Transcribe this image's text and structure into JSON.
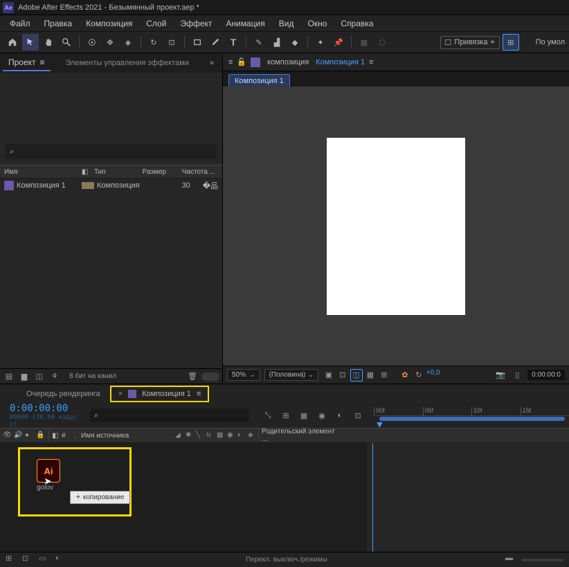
{
  "title": "Adobe After Effects 2021 - Безымянный проект.aep *",
  "logo": "Ae",
  "menu": [
    "Файл",
    "Правка",
    "Композиция",
    "Слой",
    "Эффект",
    "Анимация",
    "Вид",
    "Окно",
    "Справка"
  ],
  "toolbar": {
    "snap_label": "Привязка",
    "workspace_label": "По умол"
  },
  "project": {
    "tab": "Проект",
    "effect_controls": "Элементы управления эффектами",
    "headers": {
      "name": "Имя",
      "type": "Тип",
      "size": "Размер",
      "rate": "Частота ..."
    },
    "row": {
      "name": "Композиция 1",
      "type": "Композиция",
      "rate": "30"
    },
    "footer_bpc": "8 бит на канал"
  },
  "viewer": {
    "crumb_label": "композиция",
    "crumb_active": "Композиция 1",
    "subtab": "Композиция 1",
    "zoom": "50%",
    "resolution": "(Половина)",
    "exposure": "+0,0",
    "timecode": "0:00:00:0"
  },
  "timeline": {
    "render_queue": "Очередь рендеринга",
    "active_tab": "Композиция 1",
    "timecode": "0:00:00:00",
    "frames_label": "00000 (30.00 кадр/с)",
    "col_source": "Имя источника",
    "col_parent": "Родительский элемент ...",
    "ruler": [
      "00f",
      "05f",
      "10f",
      "15f"
    ],
    "footer_label": "Перекл. выключ./режимы"
  },
  "drag": {
    "ai_text": "Ai",
    "ai_label": "golov",
    "tooltip": "копирование"
  }
}
